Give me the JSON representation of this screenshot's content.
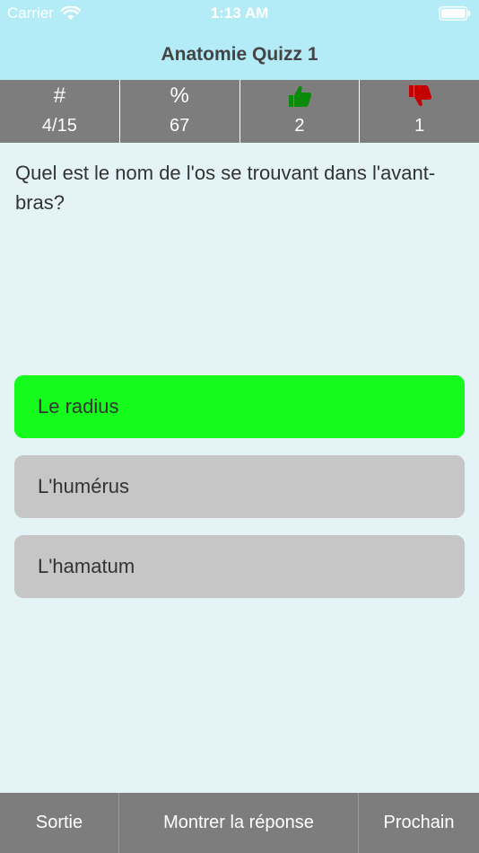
{
  "status_bar": {
    "carrier": "Carrier",
    "time": "1:13 AM"
  },
  "nav": {
    "title": "Anatomie Quizz 1"
  },
  "stats": {
    "number": {
      "header": "#",
      "value": "4/15"
    },
    "percent": {
      "header": "%",
      "value": "67"
    },
    "correct": {
      "icon": "thumbs-up-icon",
      "value": "2",
      "color": "#0a8a0a"
    },
    "wrong": {
      "icon": "thumbs-down-icon",
      "value": "1",
      "color": "#c40000"
    }
  },
  "question": {
    "text": "Quel est le nom de l'os se trouvant dans l'avant-bras?"
  },
  "answers": [
    {
      "label": "Le radius",
      "state": "correct",
      "color": "#15fb1b"
    },
    {
      "label": "L'humérus",
      "state": "neutral",
      "color": "#c6c6c6"
    },
    {
      "label": "L'hamatum",
      "state": "neutral",
      "color": "#c6c6c6"
    }
  ],
  "toolbar": {
    "exit_label": "Sortie",
    "show_answer_label": "Montrer la réponse",
    "next_label": "Prochain"
  }
}
